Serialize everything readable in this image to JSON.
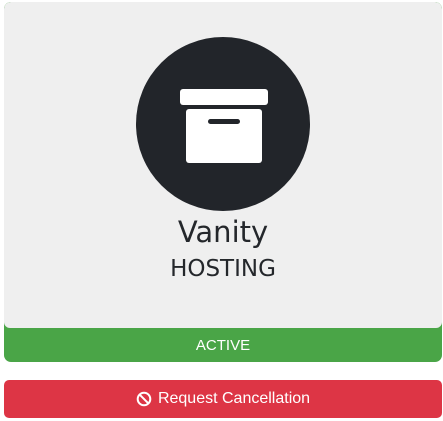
{
  "product": {
    "icon": "archive-box-icon",
    "name": "Vanity",
    "group": "HOSTING",
    "status": "ACTIVE"
  },
  "actions": {
    "cancel_label": "Request Cancellation",
    "cancel_icon": "ban-icon"
  },
  "colors": {
    "card_background": "#efefef",
    "icon_circle": "#22252a",
    "status_active": "#4aa547",
    "cancel_button": "#dd3545"
  }
}
